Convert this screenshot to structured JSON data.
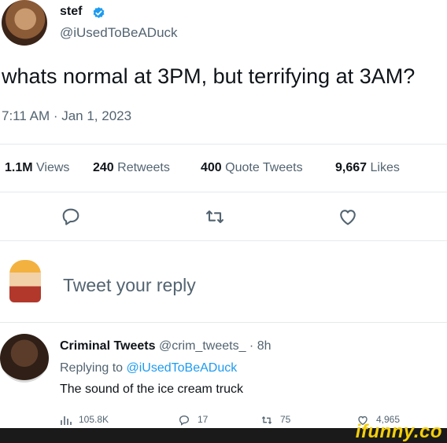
{
  "tweet": {
    "author_name": "stef",
    "author_handle": "@iUsedToBeADuck",
    "text": "whats normal at 3PM, but terrifying at 3AM?",
    "timestamp": "7:11 AM · Jan 1, 2023",
    "stats": {
      "views_count": "1.1M",
      "views_label": "Views",
      "retweets_count": "240",
      "retweets_label": "Retweets",
      "quotes_count": "400",
      "quotes_label": "Quote Tweets",
      "likes_count": "9,667",
      "likes_label": "Likes"
    }
  },
  "reply_box": {
    "placeholder": "Tweet your reply"
  },
  "reply": {
    "author_name": "Criminal Tweets",
    "author_handle": "@crim_tweets_",
    "time": "· 8h",
    "replying_prefix": "Replying to",
    "replying_to": "@iUsedToBeADuck",
    "text": "The sound of the ice cream truck",
    "views": "105.8K",
    "replies": "17",
    "retweets": "75",
    "likes": "4,965"
  },
  "watermark": "ifunny.co",
  "colors": {
    "accent": "#1d9bf0",
    "muted": "#536471",
    "watermark": "#f4cf0a"
  }
}
